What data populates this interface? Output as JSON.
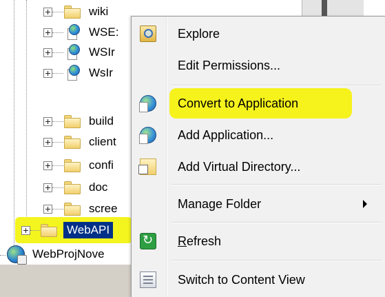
{
  "tree": {
    "items": [
      {
        "label": "wiki",
        "icon": "folder-icon"
      },
      {
        "label": "WSE:",
        "icon": "web-application-icon"
      },
      {
        "label": "WSIr",
        "icon": "web-application-icon"
      },
      {
        "label": "WsIr",
        "icon": "web-application-icon"
      },
      {
        "label": "build",
        "icon": "folder-icon"
      },
      {
        "label": "client",
        "icon": "folder-icon"
      },
      {
        "label": "confi",
        "icon": "folder-icon"
      },
      {
        "label": "doc",
        "icon": "folder-icon"
      },
      {
        "label": "scree",
        "icon": "folder-icon"
      }
    ],
    "selected_item": {
      "label": "WebAPI",
      "icon": "folder-icon"
    },
    "site_item": {
      "label": "WebProjNove",
      "icon": "globe-icon"
    }
  },
  "context_menu": {
    "items": [
      {
        "label": "Explore",
        "icon": "explore-icon"
      },
      {
        "label": "Edit Permissions...",
        "icon": ""
      },
      {
        "label": "Convert to Application",
        "icon": "convert-application-icon",
        "highlighted": true
      },
      {
        "label": "Add Application...",
        "icon": "add-application-icon"
      },
      {
        "label": "Add Virtual Directory...",
        "icon": "add-virtual-directory-icon"
      },
      {
        "label": "Manage Folder",
        "icon": "",
        "has_submenu": true
      },
      {
        "label": "Refresh",
        "icon": "refresh-icon",
        "underlined_letter": "R"
      },
      {
        "label": "Switch to Content View",
        "icon": "content-view-icon"
      }
    ]
  },
  "colors": {
    "highlight_yellow": "#f6f21c",
    "selection_blue": "#003087",
    "menu_background": "#f1f1f1"
  }
}
